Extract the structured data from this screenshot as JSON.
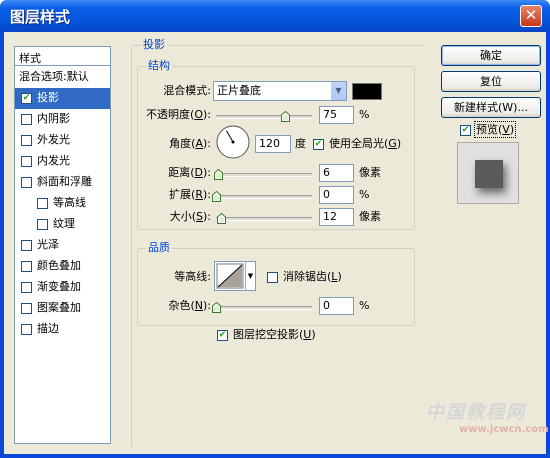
{
  "window": {
    "title": "图层样式",
    "close_glyph": "✕"
  },
  "sidebar": {
    "header": "样式",
    "items": [
      {
        "label": "混合选项:默认",
        "checkbox": false,
        "checked": false,
        "selected": false,
        "indent": 0
      },
      {
        "label": "投影",
        "checkbox": true,
        "checked": true,
        "selected": true,
        "indent": 0
      },
      {
        "label": "内阴影",
        "checkbox": true,
        "checked": false,
        "selected": false,
        "indent": 0
      },
      {
        "label": "外发光",
        "checkbox": true,
        "checked": false,
        "selected": false,
        "indent": 0
      },
      {
        "label": "内发光",
        "checkbox": true,
        "checked": false,
        "selected": false,
        "indent": 0
      },
      {
        "label": "斜面和浮雕",
        "checkbox": true,
        "checked": false,
        "selected": false,
        "indent": 0
      },
      {
        "label": "等高线",
        "checkbox": true,
        "checked": false,
        "selected": false,
        "indent": 1
      },
      {
        "label": "纹理",
        "checkbox": true,
        "checked": false,
        "selected": false,
        "indent": 1
      },
      {
        "label": "光泽",
        "checkbox": true,
        "checked": false,
        "selected": false,
        "indent": 0
      },
      {
        "label": "颜色叠加",
        "checkbox": true,
        "checked": false,
        "selected": false,
        "indent": 0
      },
      {
        "label": "渐变叠加",
        "checkbox": true,
        "checked": false,
        "selected": false,
        "indent": 0
      },
      {
        "label": "图案叠加",
        "checkbox": true,
        "checked": false,
        "selected": false,
        "indent": 0
      },
      {
        "label": "描边",
        "checkbox": true,
        "checked": false,
        "selected": false,
        "indent": 0
      }
    ]
  },
  "shadow": {
    "section_title": "投影",
    "structure": {
      "title": "结构",
      "blend_mode": {
        "label": "混合模式:",
        "value": "正片叠底",
        "color": "#000000"
      },
      "opacity": {
        "label_pre": "不透明度(",
        "key": "O",
        "label_post": "):",
        "value": "75",
        "unit": "%",
        "fraction": 0.75
      },
      "angle": {
        "label_pre": "角度(",
        "key": "A",
        "label_post": "):",
        "value": "120",
        "unit": "度",
        "degrees": 120
      },
      "global_light": {
        "label_pre": "使用全局光(",
        "key": "G",
        "label_post": ")",
        "checked": true
      },
      "distance": {
        "label_pre": "距离(",
        "key": "D",
        "label_post": "):",
        "value": "6",
        "unit": "像素",
        "fraction": 0.02
      },
      "spread": {
        "label_pre": "扩展(",
        "key": "R",
        "label_post": "):",
        "value": "0",
        "unit": "%",
        "fraction": 0
      },
      "size": {
        "label_pre": "大小(",
        "key": "S",
        "label_post": "):",
        "value": "12",
        "unit": "像素",
        "fraction": 0.05
      }
    },
    "quality": {
      "title": "品质",
      "contour": {
        "label": "等高线:"
      },
      "anti_alias": {
        "label_pre": "消除锯齿(",
        "key": "L",
        "label_post": ")",
        "checked": false
      },
      "noise": {
        "label_pre": "杂色(",
        "key": "N",
        "label_post": "):",
        "value": "0",
        "unit": "%",
        "fraction": 0
      }
    },
    "knockout": {
      "label_pre": "图层挖空投影(",
      "key": "U",
      "label_post": ")",
      "checked": true
    }
  },
  "buttons": {
    "ok": "确定",
    "reset": "复位",
    "new_style": "新建样式(W)..."
  },
  "preview": {
    "label_pre": "预览(",
    "key": "V",
    "label_post": ")",
    "checked": true
  },
  "watermark": {
    "text": "中国教程网",
    "url": "www.jcwcn.com"
  }
}
